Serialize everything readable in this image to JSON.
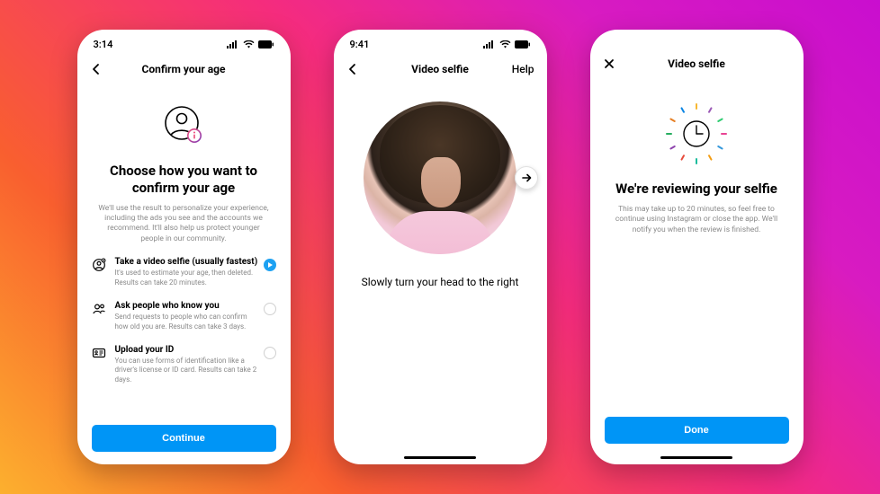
{
  "phone1": {
    "time": "3:14",
    "nav_title": "Confirm your age",
    "heading": "Choose how you want to confirm your age",
    "subtext": "We'll use the result to personalize your experience, including the ads you see and the accounts we recommend. It'll also help us protect younger people in our community.",
    "options": [
      {
        "title": "Take a video selfie (usually fastest)",
        "desc": "It's used to estimate your age, then deleted. Results can take 20 minutes.",
        "selected": true
      },
      {
        "title": "Ask people who know you",
        "desc": "Send requests to people who can confirm how old you are. Results can take 3 days.",
        "selected": false
      },
      {
        "title": "Upload your ID",
        "desc": "You can use forms of identification like a driver's license or ID card. Results can take 2 days.",
        "selected": false
      }
    ],
    "button": "Continue"
  },
  "phone2": {
    "time": "9:41",
    "nav_title": "Video selfie",
    "help": "Help",
    "instruction": "Slowly turn your head to the right"
  },
  "phone3": {
    "nav_title": "Video selfie",
    "heading": "We're reviewing your selfie",
    "subtext": "This may take up to 20 minutes, so feel free to continue using Instagram or close the app. We'll notify you when the review is finished.",
    "button": "Done"
  },
  "tick_colors": [
    "#f7b731",
    "#9b59b6",
    "#2ecc71",
    "#e84393",
    "#3498db",
    "#f39c12",
    "#1abc9c",
    "#e74c3c",
    "#8e44ad",
    "#27ae60",
    "#e67e22",
    "#0984e3"
  ]
}
